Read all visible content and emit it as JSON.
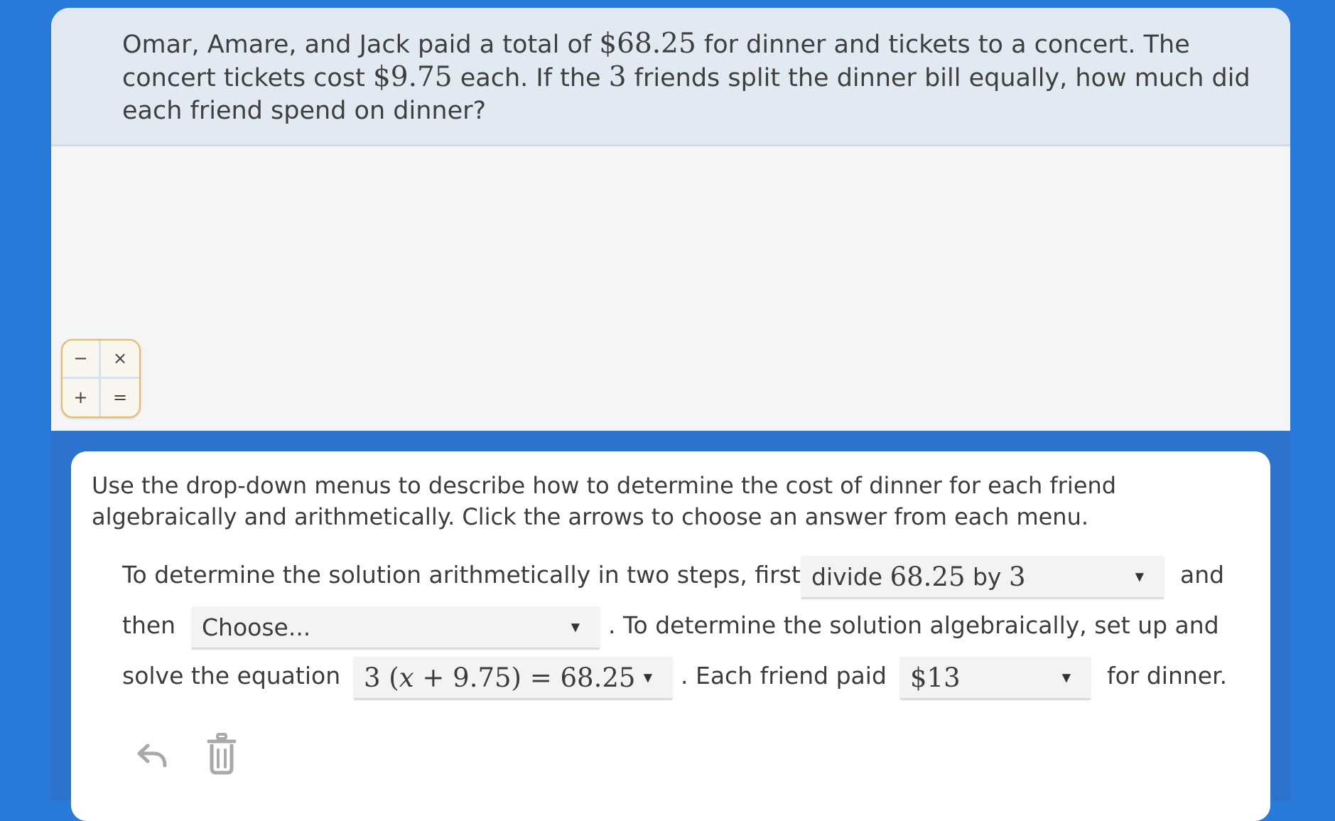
{
  "question": {
    "part1": "Omar, Amare, and Jack paid a total of ",
    "total": "$68.25",
    "part2": " for dinner and tickets to a concert. The concert tickets cost ",
    "ticket_price": "$9.75",
    "part3": " each. If the ",
    "num_friends": "3",
    "part4": " friends split the dinner bill equally, how much did each friend spend on dinner?"
  },
  "calc_pad": {
    "minus": "−",
    "times": "×",
    "plus": "+",
    "equals": "="
  },
  "instructions": "Use the drop-down menus to describe how to determine the cost of dinner for each friend algebraically and arithmetically. Click the arrows to choose an answer from each menu.",
  "sentence": {
    "line1_prefix": "To determine the solution arithmetically in two steps, first",
    "line1_suffix": "and",
    "line2_prefix": "then",
    "line2_suffix": ". To determine the solution algebraically, set up and",
    "line3_prefix": "solve the equation",
    "line3_middle": ". Each friend paid",
    "line3_suffix": "for dinner."
  },
  "dropdowns": {
    "first_step": {
      "word1": "divide ",
      "num1": "68.25",
      "word2": " by ",
      "num2": "3"
    },
    "second_step": {
      "placeholder": "Choose..."
    },
    "equation": {
      "coef": "3",
      "open": " (",
      "var": "x",
      "rest": " + 9.75) = 68.25"
    },
    "answer": {
      "value": "$13"
    },
    "arrow": "▼"
  },
  "tools": {
    "undo_icon": "undo-icon",
    "delete_icon": "trash-icon"
  }
}
